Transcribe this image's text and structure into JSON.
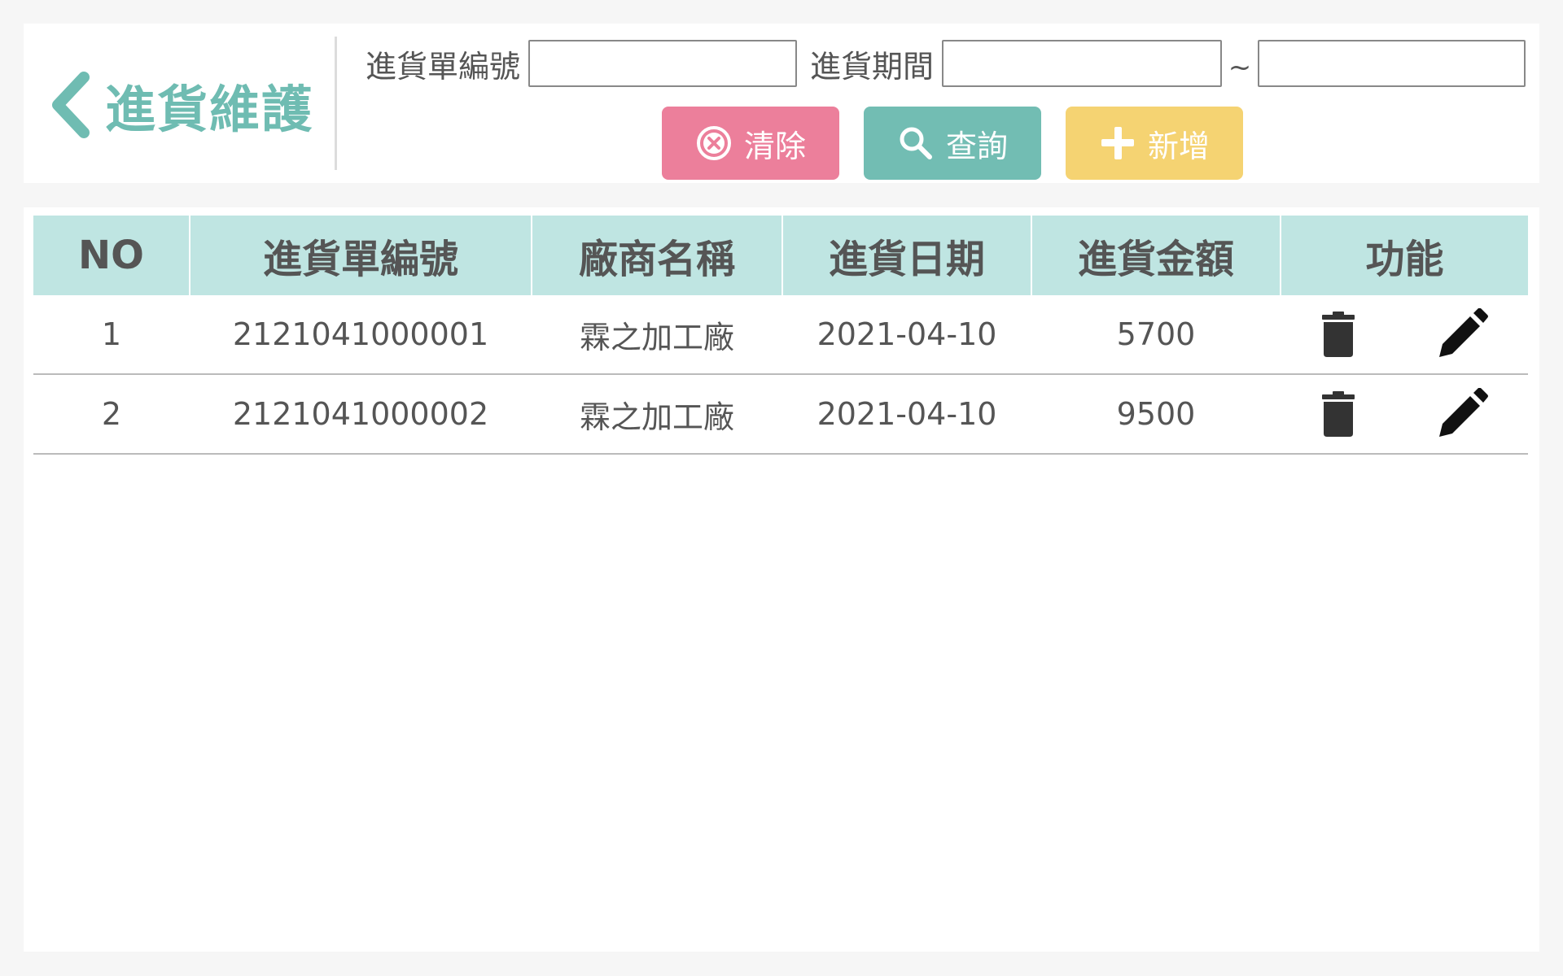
{
  "header": {
    "title": "進貨維護",
    "filters": {
      "order_no_label": "進貨單編號",
      "order_no_value": "",
      "period_label": "進貨期間",
      "date_from_value": "",
      "date_separator": "~",
      "date_to_value": ""
    },
    "buttons": {
      "clear_label": "清除",
      "search_label": "查詢",
      "add_label": "新增"
    }
  },
  "table": {
    "columns": [
      "NO",
      "進貨單編號",
      "廠商名稱",
      "進貨日期",
      "進貨金額",
      "功能"
    ],
    "rows": [
      {
        "no": "1",
        "order_no": "2121041000001",
        "vendor": "霖之加工廠",
        "date": "2021-04-10",
        "amount": "5700"
      },
      {
        "no": "2",
        "order_no": "2121041000002",
        "vendor": "霖之加工廠",
        "date": "2021-04-10",
        "amount": "9500"
      }
    ]
  },
  "colors": {
    "accent": "#6fbcb2",
    "header_bg": "#bfe5e2",
    "clear_btn": "#ec7f9b",
    "search_btn": "#72bdb3",
    "add_btn": "#f5d372"
  },
  "icons": {
    "back": "chevron-left-icon",
    "clear": "close-circle-icon",
    "search": "search-icon",
    "add": "plus-icon",
    "delete": "trash-icon",
    "edit": "pencil-icon"
  }
}
